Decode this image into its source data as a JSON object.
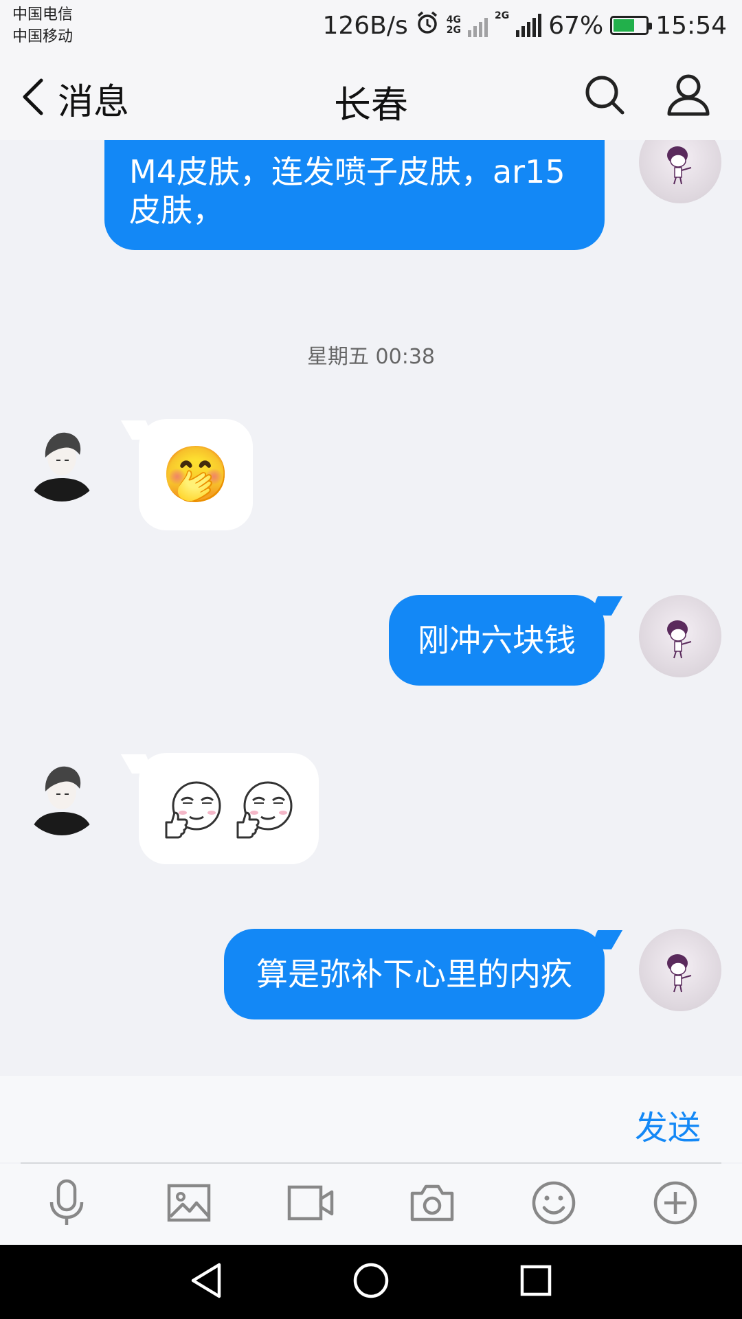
{
  "status_bar": {
    "carrier_1": "中国电信",
    "carrier_2": "中国移动",
    "net_speed": "126B/s",
    "net_1_top": "4G",
    "net_1_bottom": "2G",
    "net_2": "2G",
    "battery_pct": "67%",
    "battery_level": 0.67,
    "time": "15:54"
  },
  "header": {
    "back_label": "消息",
    "title": "长春",
    "icons": [
      "chevron-left-icon",
      "search-icon",
      "profile-icon"
    ]
  },
  "messages": [
    {
      "sender": "me",
      "type": "text",
      "text": "M4皮肤，连发喷子皮肤，ar15皮肤，",
      "partial": true
    },
    {
      "type": "timestamp",
      "text": "星期五 00:38"
    },
    {
      "sender": "them",
      "type": "emoji",
      "emoji": "🤭"
    },
    {
      "sender": "me",
      "type": "text",
      "text": "刚冲六块钱"
    },
    {
      "sender": "them",
      "type": "stickers",
      "stickers": [
        "thumbs-up-smirk",
        "thumbs-up-smirk"
      ]
    },
    {
      "sender": "me",
      "type": "text",
      "text": "算是弥补下心里的内疚"
    }
  ],
  "input": {
    "send_label": "发送"
  },
  "toolbar": [
    "microphone-icon",
    "image-icon",
    "video-icon",
    "camera-icon",
    "emoji-icon",
    "plus-icon"
  ],
  "nav_bar": [
    "back-triangle-icon",
    "home-circle-icon",
    "recents-square-icon"
  ],
  "colors": {
    "accent": "#1388f6",
    "background": "#f1f2f6",
    "bubble_them": "#ffffff",
    "battery": "#22b04b"
  }
}
